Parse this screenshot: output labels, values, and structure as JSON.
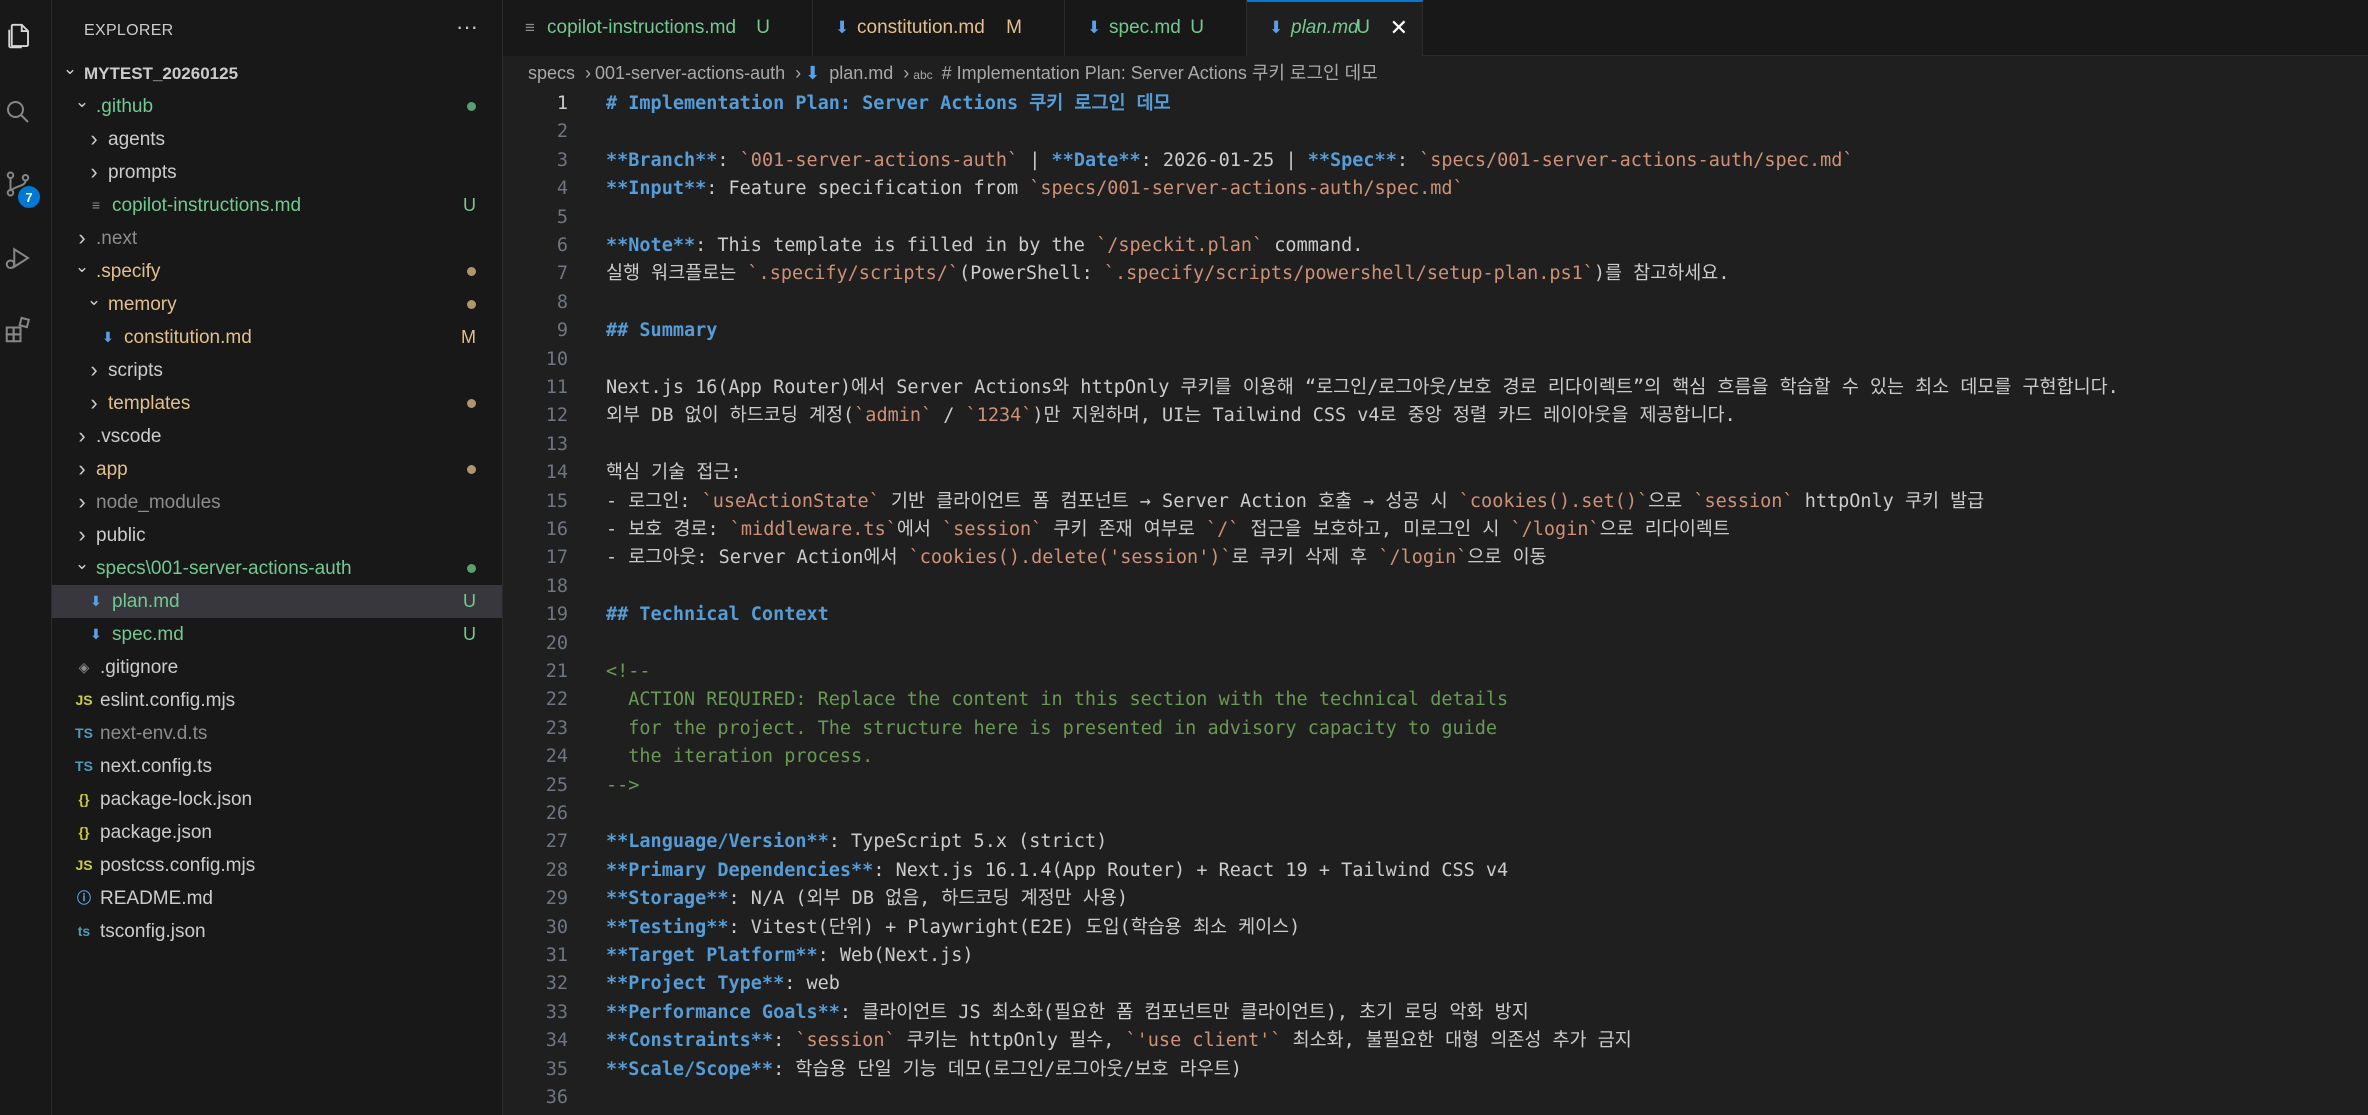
{
  "explorer": {
    "title": "EXPLORER",
    "more": "···",
    "source_control_badge": "7",
    "rows": [
      {
        "depth": 0,
        "chevron": "down",
        "icon": "",
        "label": "MYTEST_20260125",
        "color": "white",
        "bold": true,
        "status": "",
        "dot": ""
      },
      {
        "depth": 1,
        "chevron": "down",
        "icon": "",
        "label": ".github",
        "color": "green",
        "status": "",
        "dot": "#73c991"
      },
      {
        "depth": 2,
        "chevron": "right",
        "icon": "",
        "label": "agents",
        "color": "white",
        "status": "",
        "dot": ""
      },
      {
        "depth": 2,
        "chevron": "right",
        "icon": "",
        "label": "prompts",
        "color": "white",
        "status": "",
        "dot": ""
      },
      {
        "depth": 2,
        "chevron": "",
        "icon": "≡",
        "label": "copilot-instructions.md",
        "color": "green",
        "status": "U",
        "dot": ""
      },
      {
        "depth": 1,
        "chevron": "right",
        "icon": "",
        "label": ".next",
        "color": "gray",
        "status": "",
        "dot": ""
      },
      {
        "depth": 1,
        "chevron": "down",
        "icon": "",
        "label": ".specify",
        "color": "yellow",
        "status": "",
        "dot": "#e2c08d"
      },
      {
        "depth": 2,
        "chevron": "down",
        "icon": "",
        "label": "memory",
        "color": "yellow",
        "status": "",
        "dot": "#e2c08d"
      },
      {
        "depth": 3,
        "chevron": "",
        "icon": "⬇",
        "label": "constitution.md",
        "color": "yellow",
        "status": "M",
        "dot": ""
      },
      {
        "depth": 2,
        "chevron": "right",
        "icon": "",
        "label": "scripts",
        "color": "white",
        "status": "",
        "dot": ""
      },
      {
        "depth": 2,
        "chevron": "right",
        "icon": "",
        "label": "templates",
        "color": "yellow",
        "status": "",
        "dot": "#e2c08d"
      },
      {
        "depth": 1,
        "chevron": "right",
        "icon": "",
        "label": ".vscode",
        "color": "white",
        "status": "",
        "dot": ""
      },
      {
        "depth": 1,
        "chevron": "right",
        "icon": "",
        "label": "app",
        "color": "yellow",
        "status": "",
        "dot": "#e2c08d"
      },
      {
        "depth": 1,
        "chevron": "right",
        "icon": "",
        "label": "node_modules",
        "color": "gray",
        "status": "",
        "dot": ""
      },
      {
        "depth": 1,
        "chevron": "right",
        "icon": "",
        "label": "public",
        "color": "white",
        "status": "",
        "dot": ""
      },
      {
        "depth": 1,
        "chevron": "down",
        "icon": "",
        "label": "specs\\001-server-actions-auth",
        "color": "green",
        "status": "",
        "dot": "#73c991"
      },
      {
        "depth": 2,
        "chevron": "",
        "icon": "⬇",
        "label": "plan.md",
        "color": "green",
        "status": "U",
        "dot": "",
        "selected": true
      },
      {
        "depth": 2,
        "chevron": "",
        "icon": "⬇",
        "label": "spec.md",
        "color": "green",
        "status": "U",
        "dot": ""
      },
      {
        "depth": 1,
        "chevron": "",
        "icon": "◈",
        "label": ".gitignore",
        "color": "white",
        "status": "",
        "dot": ""
      },
      {
        "depth": 1,
        "chevron": "",
        "icon": "JS",
        "label": "eslint.config.mjs",
        "color": "white",
        "status": "",
        "dot": ""
      },
      {
        "depth": 1,
        "chevron": "",
        "icon": "TS",
        "label": "next-env.d.ts",
        "color": "gray",
        "status": "",
        "dot": ""
      },
      {
        "depth": 1,
        "chevron": "",
        "icon": "TS",
        "label": "next.config.ts",
        "color": "white",
        "status": "",
        "dot": ""
      },
      {
        "depth": 1,
        "chevron": "",
        "icon": "{}",
        "label": "package-lock.json",
        "color": "white",
        "status": "",
        "dot": ""
      },
      {
        "depth": 1,
        "chevron": "",
        "icon": "{}",
        "label": "package.json",
        "color": "white",
        "status": "",
        "dot": ""
      },
      {
        "depth": 1,
        "chevron": "",
        "icon": "JS",
        "label": "postcss.config.mjs",
        "color": "white",
        "status": "",
        "dot": ""
      },
      {
        "depth": 1,
        "chevron": "",
        "icon": "ⓘ",
        "label": "README.md",
        "color": "white",
        "status": "",
        "dot": ""
      },
      {
        "depth": 1,
        "chevron": "",
        "icon": "ts",
        "label": "tsconfig.json",
        "color": "white",
        "status": "",
        "dot": ""
      }
    ]
  },
  "tabs": [
    {
      "icon": "≡",
      "name": "copilot-instructions.md",
      "status": "U",
      "status_color": "#73c991",
      "name_color": "#73c991",
      "active": false
    },
    {
      "icon": "⬇",
      "name": "constitution.md",
      "status": "M",
      "status_color": "#e2c08d",
      "name_color": "#e2c08d",
      "active": false
    },
    {
      "icon": "⬇",
      "name": "spec.md",
      "status": "U",
      "status_color": "#73c991",
      "name_color": "#73c991",
      "active": false
    },
    {
      "icon": "⬇",
      "name": "plan.md",
      "status": "U",
      "status_color": "#73c991",
      "name_color": "#73c991",
      "active": true,
      "close": "✕"
    }
  ],
  "breadcrumb": [
    "specs",
    "001-server-actions-auth",
    "plan.md",
    "# Implementation Plan: Server Actions 쿠키 로그인 데모"
  ],
  "editor": {
    "current_line": 1,
    "lines": [
      [
        [
          "h",
          "# Implementation Plan: Server Actions 쿠키 로그인 데모"
        ]
      ],
      [],
      [
        [
          "b",
          "**Branch**"
        ],
        [
          "n",
          ": "
        ],
        [
          "c",
          "`001-server-actions-auth`"
        ],
        [
          "n",
          " | "
        ],
        [
          "b",
          "**Date**"
        ],
        [
          "n",
          ": 2026-01-25 | "
        ],
        [
          "b",
          "**Spec**"
        ],
        [
          "n",
          ": "
        ],
        [
          "c",
          "`specs/001-server-actions-auth/spec.md`"
        ]
      ],
      [
        [
          "b",
          "**Input**"
        ],
        [
          "n",
          ": Feature specification from "
        ],
        [
          "c",
          "`specs/001-server-actions-auth/spec.md`"
        ]
      ],
      [],
      [
        [
          "b",
          "**Note**"
        ],
        [
          "n",
          ": This template is filled in by the "
        ],
        [
          "c",
          "`/speckit.plan`"
        ],
        [
          "n",
          " command."
        ]
      ],
      [
        [
          "n",
          "실행 워크플로는 "
        ],
        [
          "c",
          "`.specify/scripts/`"
        ],
        [
          "n",
          "(PowerShell: "
        ],
        [
          "c",
          "`.specify/scripts/powershell/setup-plan.ps1`"
        ],
        [
          "n",
          ")를 참고하세요."
        ]
      ],
      [],
      [
        [
          "h",
          "## Summary"
        ]
      ],
      [],
      [
        [
          "n",
          "Next.js 16(App Router)에서 Server Actions와 httpOnly 쿠키를 이용해 “로그인/로그아웃/보호 경로 리다이렉트”의 핵심 흐름을 학습할 수 있는 최소 데모를 구현합니다."
        ]
      ],
      [
        [
          "n",
          "외부 DB 없이 하드코딩 계정("
        ],
        [
          "c",
          "`admin`"
        ],
        [
          "n",
          " / "
        ],
        [
          "c",
          "`1234`"
        ],
        [
          "n",
          ")만 지원하며, UI는 Tailwind CSS v4로 중앙 정렬 카드 레이아웃을 제공합니다."
        ]
      ],
      [],
      [
        [
          "n",
          "핵심 기술 접근:"
        ]
      ],
      [
        [
          "n",
          "- 로그인: "
        ],
        [
          "c",
          "`useActionState`"
        ],
        [
          "n",
          " 기반 클라이언트 폼 컴포넌트 → Server Action 호출 → 성공 시 "
        ],
        [
          "c",
          "`cookies().set()`"
        ],
        [
          "n",
          "으로 "
        ],
        [
          "c",
          "`session`"
        ],
        [
          "n",
          " httpOnly 쿠키 발급"
        ]
      ],
      [
        [
          "n",
          "- 보호 경로: "
        ],
        [
          "c",
          "`middleware.ts`"
        ],
        [
          "n",
          "에서 "
        ],
        [
          "c",
          "`session`"
        ],
        [
          "n",
          " 쿠키 존재 여부로 "
        ],
        [
          "c",
          "`/`"
        ],
        [
          "n",
          " 접근을 보호하고, 미로그인 시 "
        ],
        [
          "c",
          "`/login`"
        ],
        [
          "n",
          "으로 리다이렉트"
        ]
      ],
      [
        [
          "n",
          "- 로그아웃: Server Action에서 "
        ],
        [
          "c",
          "`cookies().delete('session')`"
        ],
        [
          "n",
          "로 쿠키 삭제 후 "
        ],
        [
          "c",
          "`/login`"
        ],
        [
          "n",
          "으로 이동"
        ]
      ],
      [],
      [
        [
          "h",
          "## Technical Context"
        ]
      ],
      [],
      [
        [
          "cm",
          "<!--"
        ]
      ],
      [
        [
          "cm",
          "  ACTION REQUIRED: Replace the content in this section with the technical details"
        ]
      ],
      [
        [
          "cm",
          "  for the project. The structure here is presented in advisory capacity to guide"
        ]
      ],
      [
        [
          "cm",
          "  the iteration process."
        ]
      ],
      [
        [
          "cm",
          "-->"
        ]
      ],
      [],
      [
        [
          "b",
          "**Language/Version**"
        ],
        [
          "n",
          ": TypeScript 5.x (strict)"
        ]
      ],
      [
        [
          "b",
          "**Primary Dependencies**"
        ],
        [
          "n",
          ": Next.js 16.1.4(App Router) + React 19 + Tailwind CSS v4"
        ]
      ],
      [
        [
          "b",
          "**Storage**"
        ],
        [
          "n",
          ": N/A (외부 DB 없음, 하드코딩 계정만 사용)"
        ]
      ],
      [
        [
          "b",
          "**Testing**"
        ],
        [
          "n",
          ": Vitest(단위) + Playwright(E2E) 도입(학습용 최소 케이스)"
        ]
      ],
      [
        [
          "b",
          "**Target Platform**"
        ],
        [
          "n",
          ": Web(Next.js)"
        ]
      ],
      [
        [
          "b",
          "**Project Type**"
        ],
        [
          "n",
          ": web"
        ]
      ],
      [
        [
          "b",
          "**Performance Goals**"
        ],
        [
          "n",
          ": 클라이언트 JS 최소화(필요한 폼 컴포넌트만 클라이언트), 초기 로딩 악화 방지"
        ]
      ],
      [
        [
          "b",
          "**Constraints**"
        ],
        [
          "n",
          ": "
        ],
        [
          "c",
          "`session`"
        ],
        [
          "n",
          " 쿠키는 httpOnly 필수, "
        ],
        [
          "c",
          "`'use client'`"
        ],
        [
          "n",
          " 최소화, 불필요한 대형 의존성 추가 금지"
        ]
      ],
      [
        [
          "b",
          "**Scale/Scope**"
        ],
        [
          "n",
          ": 학습용 단일 기능 데모(로그인/로그아웃/보호 라우트)"
        ]
      ],
      []
    ]
  }
}
